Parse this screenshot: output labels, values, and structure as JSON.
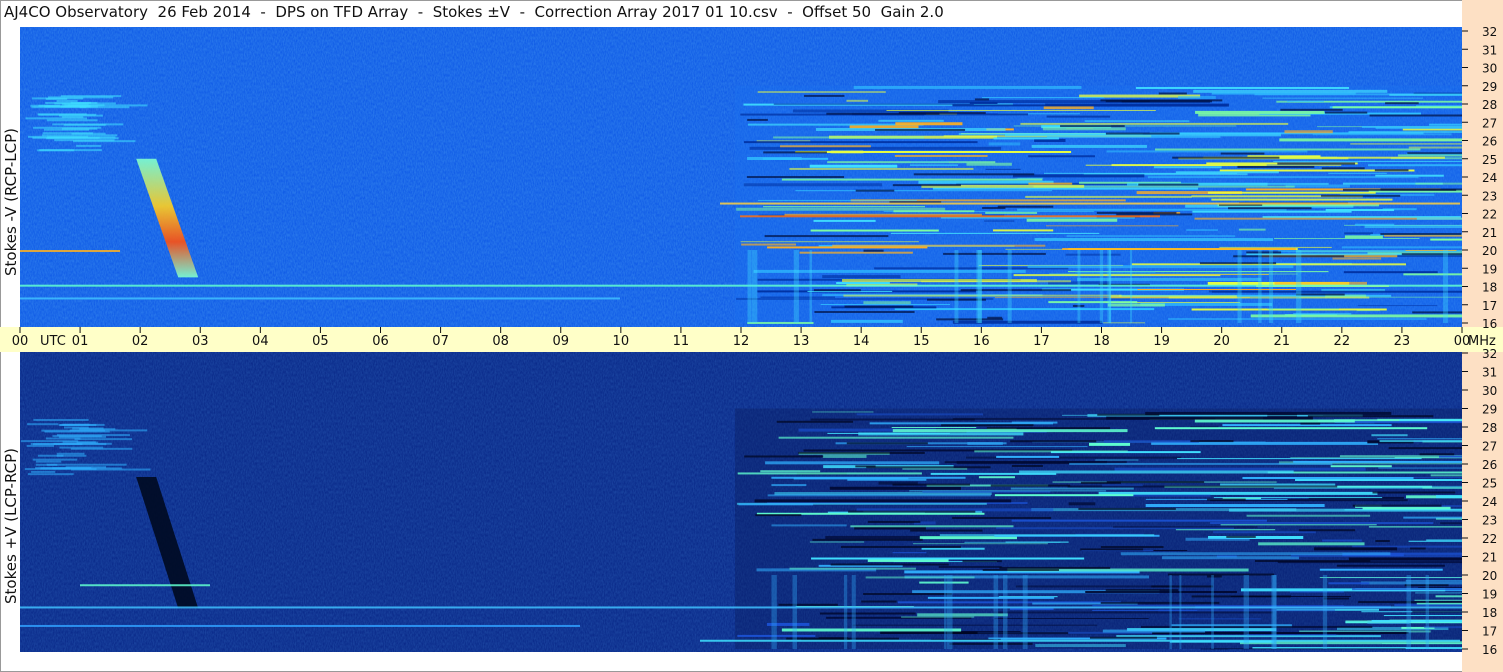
{
  "title": "AJ4CO Observatory  26 Feb 2014  -  DPS on TFD Array  -  Stokes ±V  -  Correction Array 2017 01 10.csv  -  Offset 50  Gain 2.0",
  "colors": {
    "frequency_axis_bg": "#fde0c4",
    "time_axis_bg": "#ffffc8",
    "spectrogram_low": "#000a3c",
    "spectrogram_mid": "#0f5ae6",
    "spectrogram_high": "#ff4010"
  },
  "chart_data": [
    {
      "type": "heatmap",
      "panel": "top",
      "ylabel": "Stokes -V (RCP-LCP)",
      "frequency_ticks": [
        "32",
        "31",
        "30",
        "29",
        "28",
        "27",
        "26",
        "25",
        "24",
        "23",
        "22",
        "21",
        "20",
        "19",
        "18",
        "17",
        "16"
      ],
      "frequency_unit": "MHz",
      "ylim": [
        16,
        32
      ],
      "xlim": [
        "00",
        "00"
      ],
      "colormap": "jet",
      "background": "blue",
      "features": [
        {
          "kind": "drifting burst",
          "time_utc": "02-03",
          "freq_mhz": [
            16.5,
            25
          ]
        },
        {
          "kind": "interference bands",
          "time_utc": "12-24",
          "freq_mhz": [
            16,
            29
          ]
        }
      ]
    },
    {
      "type": "heatmap",
      "panel": "bottom",
      "ylabel": "Stokes +V (LCP-RCP)",
      "frequency_ticks": [
        "32",
        "31",
        "30",
        "29",
        "28",
        "27",
        "26",
        "25",
        "24",
        "23",
        "22",
        "21",
        "20",
        "19",
        "18",
        "17",
        "16"
      ],
      "frequency_unit": "MHz",
      "ylim": [
        16,
        32
      ],
      "xlim": [
        "00",
        "00"
      ],
      "colormap": "jet",
      "background": "dark blue",
      "features": [
        {
          "kind": "drifting burst",
          "time_utc": "02-03",
          "freq_mhz": [
            17.5,
            25.5
          ]
        },
        {
          "kind": "interference bands",
          "time_utc": "12-24",
          "freq_mhz": [
            16,
            29
          ]
        }
      ]
    }
  ],
  "time_axis": {
    "ticks": [
      "00",
      "01",
      "02",
      "03",
      "04",
      "05",
      "06",
      "07",
      "08",
      "09",
      "10",
      "11",
      "12",
      "13",
      "14",
      "15",
      "16",
      "17",
      "18",
      "19",
      "20",
      "21",
      "22",
      "23",
      "00"
    ],
    "utc_label": "UTC",
    "mhz_label": "MHz"
  }
}
